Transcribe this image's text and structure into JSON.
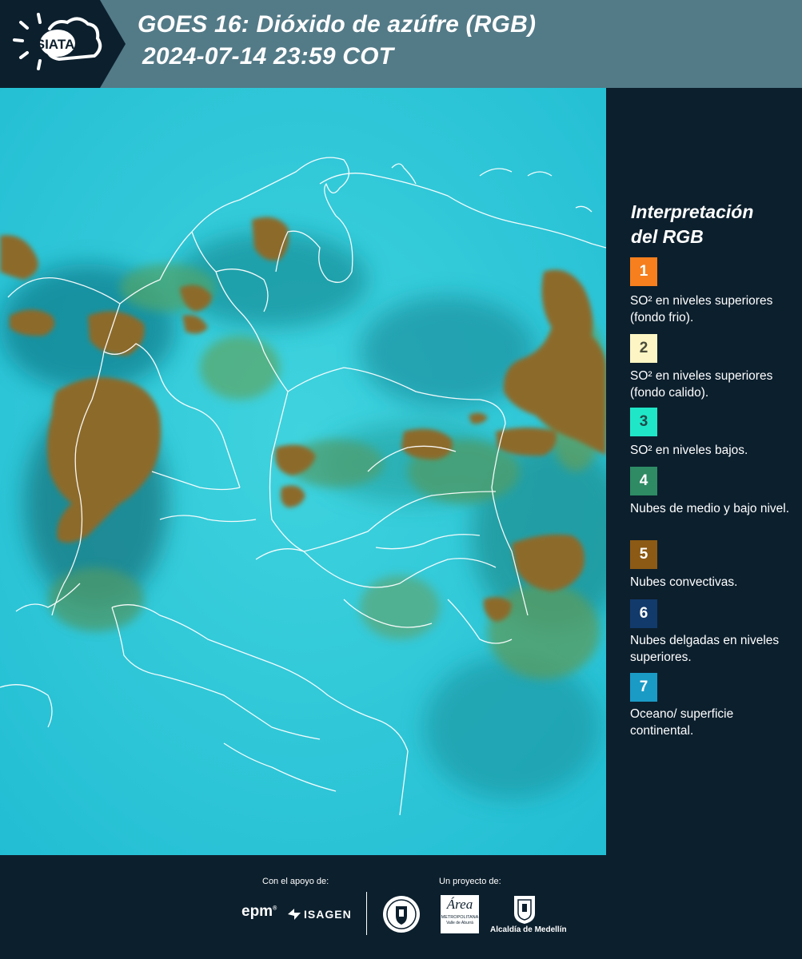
{
  "header": {
    "logo_text": "SIATA",
    "title_line1": "GOES 16: Dióxido de azúfre (RGB)",
    "title_line2": "2024-07-14 23:59 COT"
  },
  "legend": {
    "title_line1": "Interpretación",
    "title_line2": "del RGB",
    "items": [
      {
        "number": "1",
        "color": "#f77f1e",
        "label": "SO² en niveles superiores (fondo frio)."
      },
      {
        "number": "2",
        "color": "#fdf6c4",
        "label": "SO² en niveles superiores (fondo calido)."
      },
      {
        "number": "3",
        "color": "#20e6c8",
        "label": "SO² en niveles bajos."
      },
      {
        "number": "4",
        "color": "#2e8b64",
        "label": "Nubes de medio y bajo nivel."
      },
      {
        "number": "5",
        "color": "#8c5a14",
        "label": "Nubes convectivas."
      },
      {
        "number": "6",
        "color": "#123a6b",
        "label": "Nubes delgadas en niveles superiores."
      },
      {
        "number": "7",
        "color": "#1a9bc6",
        "label": "Oceano/ superficie continental."
      }
    ]
  },
  "footer": {
    "support_label": "Con el apoyo de:",
    "project_label": "Un proyecto de:",
    "logos": {
      "epm": "epm",
      "isagen": "ISAGEN",
      "metropolitana_main": "Área",
      "metropolitana_sub": "METROPOLITANA",
      "metropolitana_sub2": "Valle de Aburrá",
      "alcaldia": "Alcaldía de Medellín"
    }
  },
  "colors": {
    "background": "#0c1f2d",
    "header_band": "#537a87",
    "map_base": "#2ec4d6",
    "convective": "#8c6a2a",
    "low_cloud": "#3e9e7a"
  }
}
